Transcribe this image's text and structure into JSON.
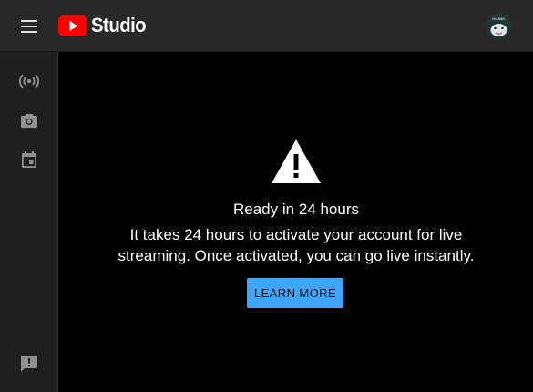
{
  "header": {
    "logo_text": "Studio",
    "menu_icon": "menu-icon",
    "avatar_text": "CHANNEL"
  },
  "sidebar": {
    "items": [
      {
        "icon": "broadcast-icon"
      },
      {
        "icon": "camera-icon"
      },
      {
        "icon": "calendar-icon"
      },
      {
        "icon": "feedback-icon"
      }
    ]
  },
  "main": {
    "icon": "warning-icon",
    "title": "Ready in 24 hours",
    "description": "It takes 24 hours to activate your account for live streaming. Once activated, you can go live instantly.",
    "button_label": "LEARN MORE"
  },
  "colors": {
    "topbar": "#282828",
    "sidebar": "#1f1f1f",
    "background": "#000000",
    "accent": "#3ea6ff",
    "youtube_red": "#ff0000"
  }
}
